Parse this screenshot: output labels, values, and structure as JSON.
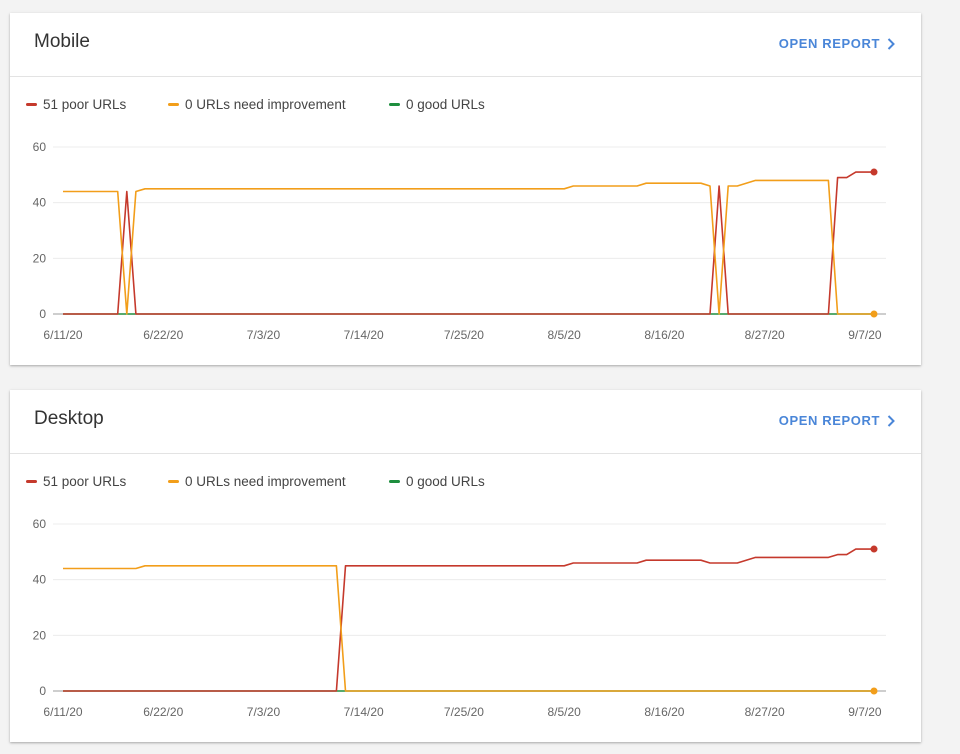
{
  "colors": {
    "poor": "#c5392c",
    "needs_improvement": "#f29e1a",
    "good": "#1e8e3e",
    "link": "#4a86d8"
  },
  "cards": [
    {
      "title": "Mobile",
      "open_report_label": "OPEN REPORT",
      "legend": {
        "poor": "51 poor URLs",
        "needs_improvement": "0 URLs need improvement",
        "good": "0 good URLs"
      },
      "y_ticks": [
        "60",
        "40",
        "20",
        "0"
      ],
      "x_ticks": [
        "6/11/20",
        "6/22/20",
        "7/3/20",
        "7/14/20",
        "7/25/20",
        "8/5/20",
        "8/16/20",
        "8/27/20",
        "9/7/20"
      ]
    },
    {
      "title": "Desktop",
      "open_report_label": "OPEN REPORT",
      "legend": {
        "poor": "51 poor URLs",
        "needs_improvement": "0 URLs need improvement",
        "good": "0 good URLs"
      },
      "y_ticks": [
        "60",
        "40",
        "20",
        "0"
      ],
      "x_ticks": [
        "6/11/20",
        "6/22/20",
        "7/3/20",
        "7/14/20",
        "7/25/20",
        "8/5/20",
        "8/16/20",
        "8/27/20",
        "9/7/20"
      ]
    }
  ],
  "chart_data": [
    {
      "type": "line",
      "x_start": "6/11/20",
      "x_end": "9/7/20",
      "ylim": [
        0,
        60
      ],
      "series": [
        {
          "name": "51 poor URLs",
          "color": "#c5392c",
          "points": [
            [
              0,
              0
            ],
            [
              6,
              0
            ],
            [
              7,
              44
            ],
            [
              8,
              0
            ],
            [
              71,
              0
            ],
            [
              72,
              46
            ],
            [
              73,
              0
            ],
            [
              84,
              0
            ],
            [
              85,
              49
            ],
            [
              86,
              49
            ],
            [
              87,
              51
            ],
            [
              88,
              51
            ],
            [
              89,
              51
            ]
          ]
        },
        {
          "name": "0 URLs need improvement",
          "color": "#f29e1a",
          "points": [
            [
              0,
              44
            ],
            [
              6,
              44
            ],
            [
              7,
              0
            ],
            [
              8,
              44
            ],
            [
              9,
              45
            ],
            [
              55,
              45
            ],
            [
              56,
              46
            ],
            [
              63,
              46
            ],
            [
              64,
              47
            ],
            [
              70,
              47
            ],
            [
              71,
              46
            ],
            [
              72,
              0
            ],
            [
              73,
              46
            ],
            [
              74,
              46
            ],
            [
              76,
              48
            ],
            [
              84,
              48
            ],
            [
              85,
              0
            ],
            [
              89,
              0
            ]
          ]
        },
        {
          "name": "0 good URLs",
          "color": "#1e8e3e",
          "points": [
            [
              0,
              0
            ],
            [
              89,
              0
            ]
          ]
        }
      ]
    },
    {
      "type": "line",
      "x_start": "6/11/20",
      "x_end": "9/7/20",
      "ylim": [
        0,
        60
      ],
      "series": [
        {
          "name": "51 poor URLs",
          "color": "#c5392c",
          "points": [
            [
              0,
              0
            ],
            [
              30,
              0
            ],
            [
              31,
              45
            ],
            [
              55,
              45
            ],
            [
              56,
              46
            ],
            [
              63,
              46
            ],
            [
              64,
              47
            ],
            [
              70,
              47
            ],
            [
              71,
              46
            ],
            [
              74,
              46
            ],
            [
              76,
              48
            ],
            [
              84,
              48
            ],
            [
              85,
              49
            ],
            [
              86,
              49
            ],
            [
              87,
              51
            ],
            [
              89,
              51
            ]
          ]
        },
        {
          "name": "0 URLs need improvement",
          "color": "#f29e1a",
          "points": [
            [
              0,
              44
            ],
            [
              8,
              44
            ],
            [
              9,
              45
            ],
            [
              30,
              45
            ],
            [
              31,
              0
            ],
            [
              89,
              0
            ]
          ]
        },
        {
          "name": "0 good URLs",
          "color": "#1e8e3e",
          "points": [
            [
              0,
              0
            ],
            [
              89,
              0
            ]
          ]
        }
      ]
    }
  ]
}
